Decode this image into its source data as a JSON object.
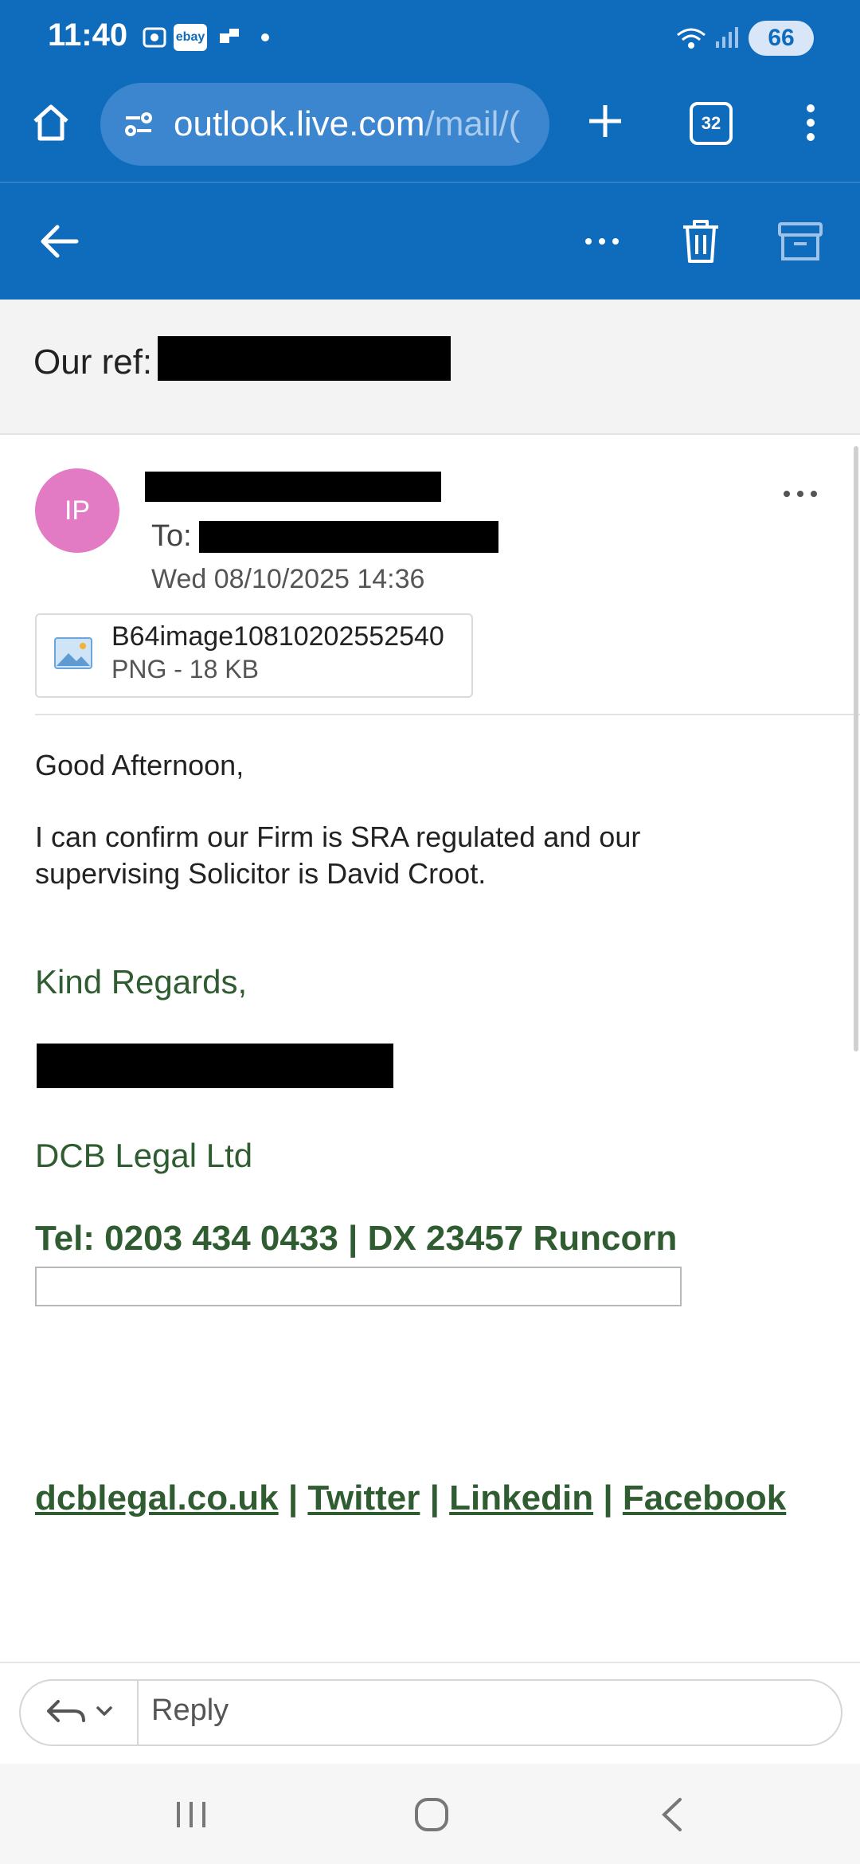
{
  "status": {
    "time": "11:40",
    "ebay": "ebay",
    "battery": "66"
  },
  "browser": {
    "url_main": "outlook.live.com",
    "url_rest": "/mail/(",
    "tabs_count": "32"
  },
  "email": {
    "subject_prefix": "Our ref:",
    "avatar_initials": "IP",
    "to_label": "To:",
    "date": "Wed 08/10/2025 14:36",
    "attachment": {
      "name": "B64image10810202552540",
      "meta": "PNG - 18 KB"
    },
    "greeting": "Good Afternoon,",
    "paragraph_line1": "I can confirm our Firm is SRA regulated and our",
    "paragraph_line2": "supervising Solicitor is David Croot.",
    "signoff": "Kind Regards,",
    "company": "DCB Legal Ltd",
    "tel_line": "Tel: 0203 434 0433 | DX 23457 Runcorn",
    "links": [
      "dcblegal.co.uk",
      "Twitter",
      "Linkedin",
      "Facebook"
    ],
    "link_separator": "|"
  },
  "reply": {
    "placeholder": "Reply"
  },
  "colors": {
    "brand": "#0f6cbd",
    "signature_green": "#2f5d31",
    "avatar": "#e37bc4"
  }
}
